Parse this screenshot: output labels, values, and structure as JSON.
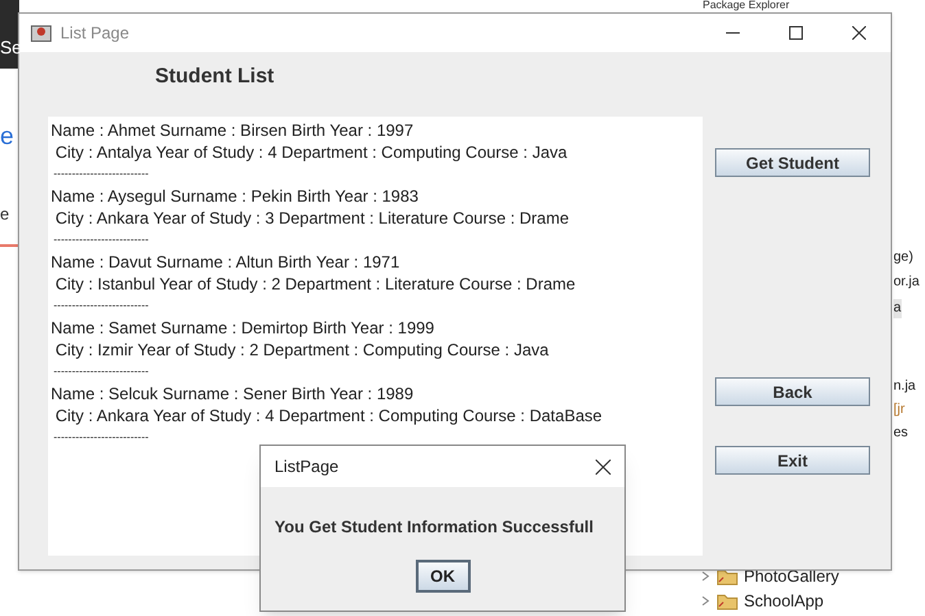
{
  "background": {
    "left_fragments": [
      {
        "text": "Se",
        "kind": "dark"
      },
      {
        "text": "e",
        "kind": "link"
      },
      {
        "text": "e",
        "kind": "plain"
      }
    ],
    "right_tab": "Package Explorer",
    "right_fragments": [
      {
        "text": "ge)",
        "kind": "plain"
      },
      {
        "text": "or.ja",
        "kind": "plain"
      },
      {
        "text": "a",
        "kind": "highlight"
      },
      {
        "text": "n.ja",
        "kind": "plain"
      },
      {
        "text": "[jr",
        "kind": "library"
      },
      {
        "text": "es",
        "kind": "plain"
      }
    ],
    "tree": [
      {
        "label": "PhotoGallery",
        "expanded": false
      },
      {
        "label": "SchoolApp",
        "expanded": false
      }
    ]
  },
  "window": {
    "title": "List Page",
    "heading": "Student List",
    "records": [
      {
        "line_1": "Name : Ahmet Surname : Birsen Birth Year : 1997",
        "line_2": " City : Antalya Year of Study : 4 Department : Computing Course : Java",
        "separator": "--------------------------"
      },
      {
        "line_1": "Name : Aysegul Surname : Pekin Birth Year : 1983",
        "line_2": " City : Ankara Year of Study : 3 Department : Literature Course : Drame",
        "separator": "--------------------------"
      },
      {
        "line_1": "Name : Davut Surname : Altun Birth Year : 1971",
        "line_2": " City : Istanbul Year of Study : 2 Department : Literature Course : Drame",
        "separator": "--------------------------"
      },
      {
        "line_1": "Name : Samet Surname : Demirtop Birth Year : 1999",
        "line_2": " City : Izmir Year of Study : 2 Department : Computing Course : Java",
        "separator": "--------------------------"
      },
      {
        "line_1": "Name : Selcuk Surname : Sener Birth Year : 1989",
        "line_2": " City : Ankara Year of Study : 4 Department : Computing Course : DataBase",
        "separator": "--------------------------"
      }
    ],
    "buttons": [
      "Get Student",
      "Back",
      "Exit"
    ]
  },
  "dialog": {
    "title": "ListPage",
    "message": "You Get Student Information Successfull",
    "button": "OK"
  }
}
